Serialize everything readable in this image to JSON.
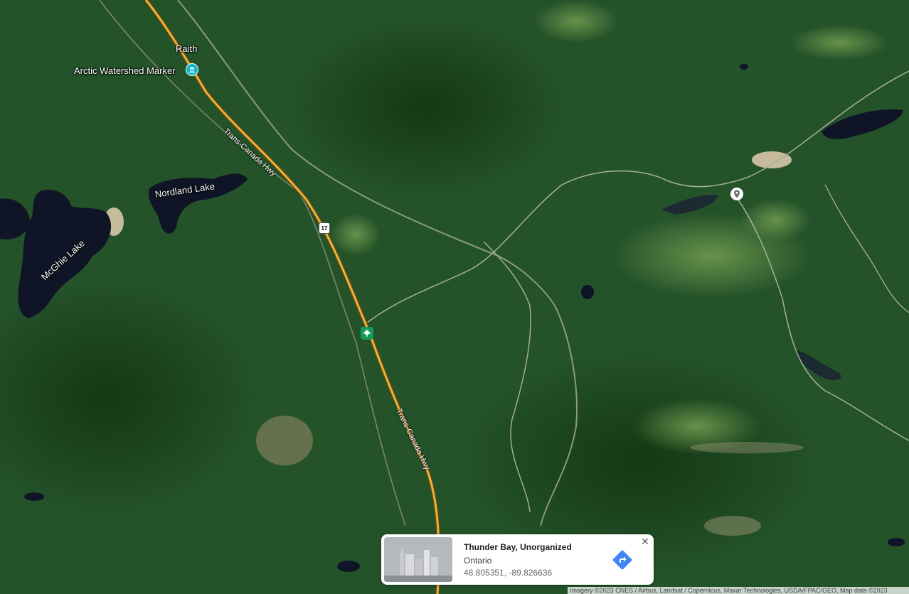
{
  "map": {
    "labels": {
      "raith": "Raith",
      "arctic_watershed": "Arctic Watershed Marker",
      "nordland_lake": "Nordland Lake",
      "mcghie_lake": "McGhie Lake",
      "trans_canada_1": "Trans-Canada Hwy",
      "trans_canada_2": "Trans-Canada Hwy",
      "hwy_number": "17"
    },
    "icons": {
      "poi": "museum-icon",
      "shield": "highway-shield-icon",
      "maple": "maple-leaf-icon",
      "pin": "location-pin-icon"
    },
    "colors": {
      "forest": "#1f4a1f",
      "highway": "#f2b233",
      "lake": "#0f1526",
      "poi": "#12b5cb",
      "maple": "#0f9d58",
      "directions": "#4285f4"
    }
  },
  "info_card": {
    "title": "Thunder Bay, Unorganized",
    "region": "Ontario",
    "coordinates": "48.805351, -89.826636",
    "close_symbol": "✕"
  },
  "attribution": "Imagery ©2023 CNES / Airbus, Landsat / Copernicus, Maxar Technologies, USDA/FPAC/GEO, Map data ©2023"
}
